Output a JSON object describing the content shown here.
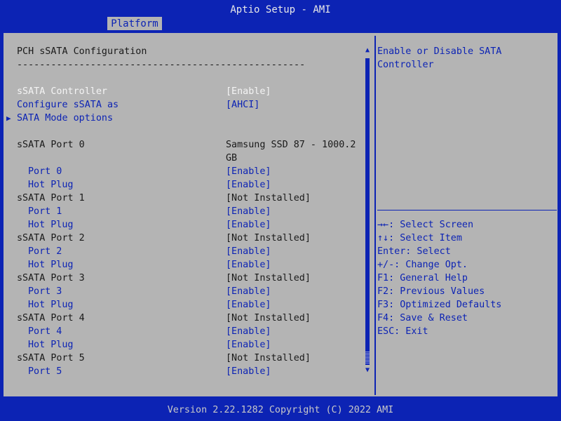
{
  "window": {
    "title": "Aptio Setup - AMI",
    "tab": "Platform",
    "footer": "Version 2.22.1282 Copyright (C) 2022 AMI"
  },
  "main": {
    "heading": "PCH sSATA Configuration",
    "separator": "---------------------------------------------------",
    "controller": {
      "label": "sSATA Controller",
      "value": "[Enable]"
    },
    "configure_as": {
      "label": "Configure sSATA as",
      "value": "[AHCI]"
    },
    "mode_options": {
      "label": "SATA Mode options"
    },
    "port0": {
      "label": "sSATA Port 0",
      "device_line1": "Samsung SSD 87 - 1000.2",
      "device_line2": "GB",
      "port_label": "Port 0",
      "port_value": "[Enable]",
      "hotplug_label": "Hot Plug",
      "hotplug_value": "[Enable]"
    },
    "port1": {
      "label": "sSATA Port 1",
      "status": "[Not Installed]",
      "port_label": "Port 1",
      "port_value": "[Enable]",
      "hotplug_label": "Hot Plug",
      "hotplug_value": "[Enable]"
    },
    "port2": {
      "label": "sSATA Port 2",
      "status": "[Not Installed]",
      "port_label": "Port 2",
      "port_value": "[Enable]",
      "hotplug_label": "Hot Plug",
      "hotplug_value": "[Enable]"
    },
    "port3": {
      "label": "sSATA Port 3",
      "status": "[Not Installed]",
      "port_label": "Port 3",
      "port_value": "[Enable]",
      "hotplug_label": "Hot Plug",
      "hotplug_value": "[Enable]"
    },
    "port4": {
      "label": "sSATA Port 4",
      "status": "[Not Installed]",
      "port_label": "Port 4",
      "port_value": "[Enable]",
      "hotplug_label": "Hot Plug",
      "hotplug_value": "[Enable]"
    },
    "port5": {
      "label": "sSATA Port 5",
      "status": "[Not Installed]",
      "port_label": "Port 5",
      "port_value": "[Enable]"
    }
  },
  "help": {
    "line1": "Enable or Disable SATA",
    "line2": "Controller"
  },
  "keys": [
    "→←: Select Screen",
    "↑↓: Select Item",
    "Enter: Select",
    "+/-: Change Opt.",
    "F1: General Help",
    "F2: Previous Values",
    "F3: Optimized Defaults",
    "F4: Save & Reset",
    "ESC: Exit"
  ],
  "icons": {
    "submenu": "triangle-right-icon",
    "scroll_up": "triangle-up-icon",
    "scroll_down": "triangle-down-icon"
  },
  "colors": {
    "background": "#0c23b4",
    "panel": "#b4b4b4",
    "selected_text": "#f4f4f4",
    "option_text": "#0c23b4"
  }
}
